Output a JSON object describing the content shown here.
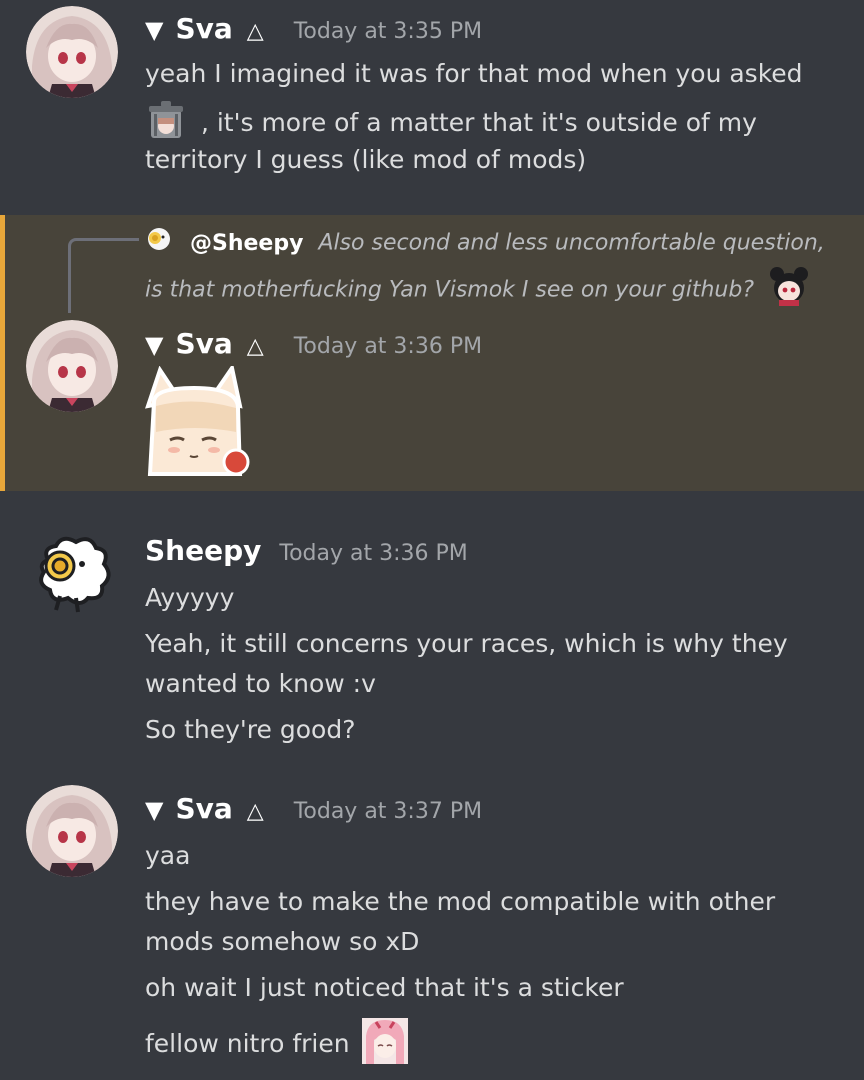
{
  "messages": [
    {
      "author": "Sva",
      "tri": "▼",
      "delta": "△",
      "timestamp": "Today at 3:35 PM",
      "lines": [
        "yeah I imagined it was for that mod when you asked",
        ", it's more of a matter that it's outside of my",
        "territory I guess (like mod of mods)"
      ]
    },
    {
      "reply": {
        "mention": "@Sheepy",
        "text_line1": "Also second and less uncomfortable question,",
        "text_line2": "is that motherfucking Yan Vismok I see on your github?"
      },
      "author": "Sva",
      "tri": "▼",
      "delta": "△",
      "timestamp": "Today at 3:36 PM"
    },
    {
      "author": "Sheepy",
      "timestamp": "Today at 3:36 PM",
      "lines": [
        "Ayyyyy",
        "Yeah, it still concerns your races, which is why they",
        "wanted to know :v",
        "So they're good?"
      ]
    },
    {
      "author": "Sva",
      "tri": "▼",
      "delta": "△",
      "timestamp": "Today at 3:37 PM",
      "lines": [
        "yaa",
        "they have to make the mod compatible with other",
        "mods somehow so xD",
        "oh wait I just noticed that it's a sticker",
        "fellow nitro frien"
      ]
    }
  ],
  "colors": {
    "background": "#36393f",
    "highlight": "#48443a",
    "highlight_bar": "#e8a73a",
    "username": "#ffffff",
    "timestamp": "#a3a6aa",
    "text": "#dcddde"
  },
  "icons": {
    "sva_avatar": "anime-girl-avatar",
    "sheepy_avatar": "sheep-avatar",
    "garbage_emoji": "garbage-can-emoji",
    "reply_sheep": "sheep-icon",
    "reply_emoji": "anime-girl-emoji",
    "sticker": "fox-girl-sticker",
    "nitro_emoji": "pink-haired-girl-emoji"
  }
}
